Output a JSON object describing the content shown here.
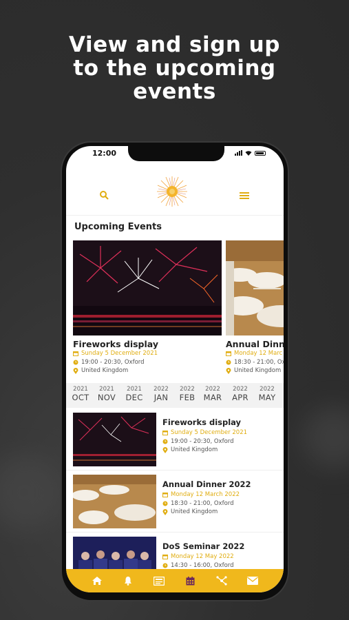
{
  "headline": {
    "line1": "View and sign up",
    "line2": "to the upcoming",
    "line3": "events"
  },
  "status": {
    "time": "12:00"
  },
  "section": {
    "title": "Upcoming Events"
  },
  "carousel": [
    {
      "title": "Fireworks display",
      "date": "Sunday 5 December 2021",
      "time": "19:00 - 20:30, Oxford",
      "location": "United Kingdom"
    },
    {
      "title": "Annual Dinn",
      "date": "Monday 12 Marc",
      "time": "18:30 - 21:00, Oxf",
      "location": "United Kingdom"
    }
  ],
  "months": [
    {
      "year": "2021",
      "month": "OCT"
    },
    {
      "year": "2021",
      "month": "NOV"
    },
    {
      "year": "2021",
      "month": "DEC"
    },
    {
      "year": "2022",
      "month": "JAN"
    },
    {
      "year": "2022",
      "month": "FEB"
    },
    {
      "year": "2022",
      "month": "MAR"
    },
    {
      "year": "2022",
      "month": "APR"
    },
    {
      "year": "2022",
      "month": "MAY"
    }
  ],
  "events": [
    {
      "title": "Fireworks display",
      "date": "Sunday 5 December 2021",
      "time": "19:00 - 20:30, Oxford",
      "location": "United Kingdom"
    },
    {
      "title": "Annual Dinner 2022",
      "date": "Monday 12 March 2022",
      "time": "18:30 - 21:00, Oxford",
      "location": "United Kingdom"
    },
    {
      "title": "DoS Seminar 2022",
      "date": "Monday 12 May 2022",
      "time": "14:30 - 16:00, Oxford",
      "location": ""
    }
  ],
  "tabs": [
    "home-icon",
    "bell-icon",
    "news-icon",
    "calendar-icon",
    "network-icon",
    "mail-icon"
  ],
  "colors": {
    "accent": "#f0b81c",
    "date_text": "#e0ad10",
    "active_tab": "#6b2a5c"
  }
}
